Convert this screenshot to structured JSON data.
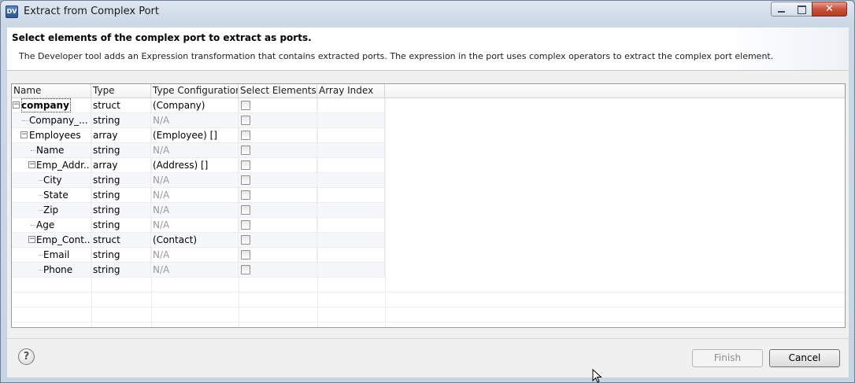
{
  "window": {
    "icon_text": "DV",
    "title": "Extract from Complex Port",
    "close_glyph": "✕"
  },
  "header": {
    "title": "Select elements of the complex port to extract as ports.",
    "description": "The Developer tool adds an Expression transformation that contains extracted ports. The expression in the port uses complex operators to extract the complex port element."
  },
  "table": {
    "columns": [
      "Name",
      "Type",
      "Type Configuration",
      "Select Elements",
      "Array Index"
    ],
    "rows": [
      {
        "name": "company",
        "type": "struct",
        "config": "(Company)"
      },
      {
        "name": "Company_...",
        "type": "string",
        "config": "N/A"
      },
      {
        "name": "Employees",
        "type": "array",
        "config": "(Employee) []"
      },
      {
        "name": "Name",
        "type": "string",
        "config": "N/A"
      },
      {
        "name": "Emp_Addr...",
        "type": "array",
        "config": "(Address) []"
      },
      {
        "name": "City",
        "type": "string",
        "config": "N/A"
      },
      {
        "name": "State",
        "type": "string",
        "config": "N/A"
      },
      {
        "name": "Zip",
        "type": "string",
        "config": "N/A"
      },
      {
        "name": "Age",
        "type": "string",
        "config": "N/A"
      },
      {
        "name": "Emp_Cont...",
        "type": "struct",
        "config": "(Contact)"
      },
      {
        "name": "Email",
        "type": "string",
        "config": "N/A"
      },
      {
        "name": "Phone",
        "type": "string",
        "config": "N/A"
      }
    ],
    "expander_glyph": "−"
  },
  "footer": {
    "help_glyph": "?",
    "finish_label": "Finish",
    "cancel_label": "Cancel"
  }
}
